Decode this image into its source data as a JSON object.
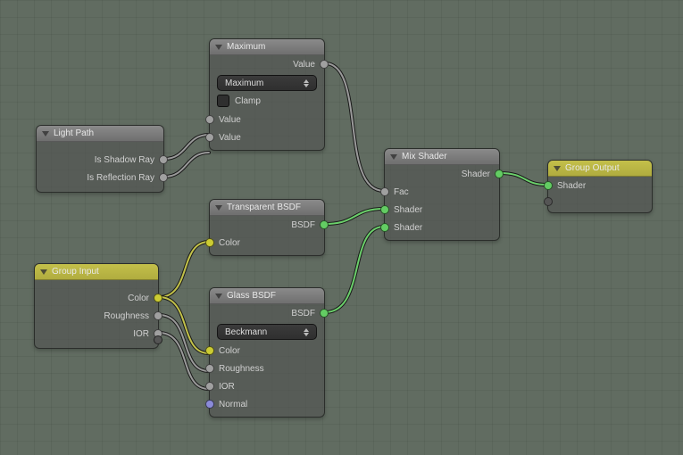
{
  "nodes": {
    "light_path": {
      "title": "Light Path",
      "outputs": {
        "shadow": "Is Shadow Ray",
        "reflect": "Is Reflection Ray"
      }
    },
    "maximum": {
      "title": "Maximum",
      "out_value": "Value",
      "op_select": "Maximum",
      "clamp": "Clamp",
      "in_a": "Value",
      "in_b": "Value"
    },
    "group_input": {
      "title": "Group Input",
      "outputs": {
        "color": "Color",
        "rough": "Roughness",
        "ior": "IOR"
      }
    },
    "transparent": {
      "title": "Transparent BSDF",
      "out_bsdf": "BSDF",
      "in_color": "Color"
    },
    "glass": {
      "title": "Glass BSDF",
      "out_bsdf": "BSDF",
      "dist_select": "Beckmann",
      "in_color": "Color",
      "in_rough": "Roughness",
      "in_ior": "IOR",
      "in_normal": "Normal"
    },
    "mix": {
      "title": "Mix Shader",
      "out_shader": "Shader",
      "in_fac": "Fac",
      "in_a": "Shader",
      "in_b": "Shader"
    },
    "group_output": {
      "title": "Group Output",
      "in_shader": "Shader"
    }
  }
}
